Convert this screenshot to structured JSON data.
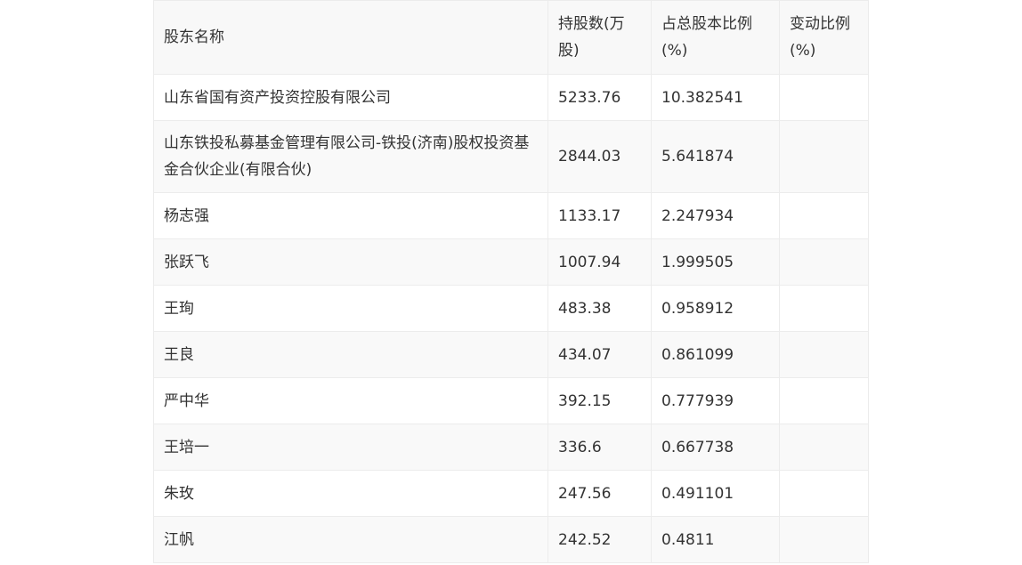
{
  "table": {
    "headers": [
      "股东名称",
      "持股数(万股)",
      "占总股本比例(%)",
      "变动比例(%)"
    ],
    "rows": [
      [
        "山东省国有资产投资控股有限公司",
        "5233.76",
        "10.382541",
        ""
      ],
      [
        "山东铁投私募基金管理有限公司-铁投(济南)股权投资基金合伙企业(有限合伙)",
        "2844.03",
        "5.641874",
        ""
      ],
      [
        "杨志强",
        "1133.17",
        "2.247934",
        ""
      ],
      [
        "张跃飞",
        "1007.94",
        "1.999505",
        ""
      ],
      [
        "王珣",
        "483.38",
        "0.958912",
        ""
      ],
      [
        "王良",
        "434.07",
        "0.861099",
        ""
      ],
      [
        "严中华",
        "392.15",
        "0.777939",
        ""
      ],
      [
        "王培一",
        "336.6",
        "0.667738",
        ""
      ],
      [
        "朱玫",
        "247.56",
        "0.491101",
        ""
      ],
      [
        "江帆",
        "242.52",
        "0.4811",
        ""
      ]
    ]
  }
}
